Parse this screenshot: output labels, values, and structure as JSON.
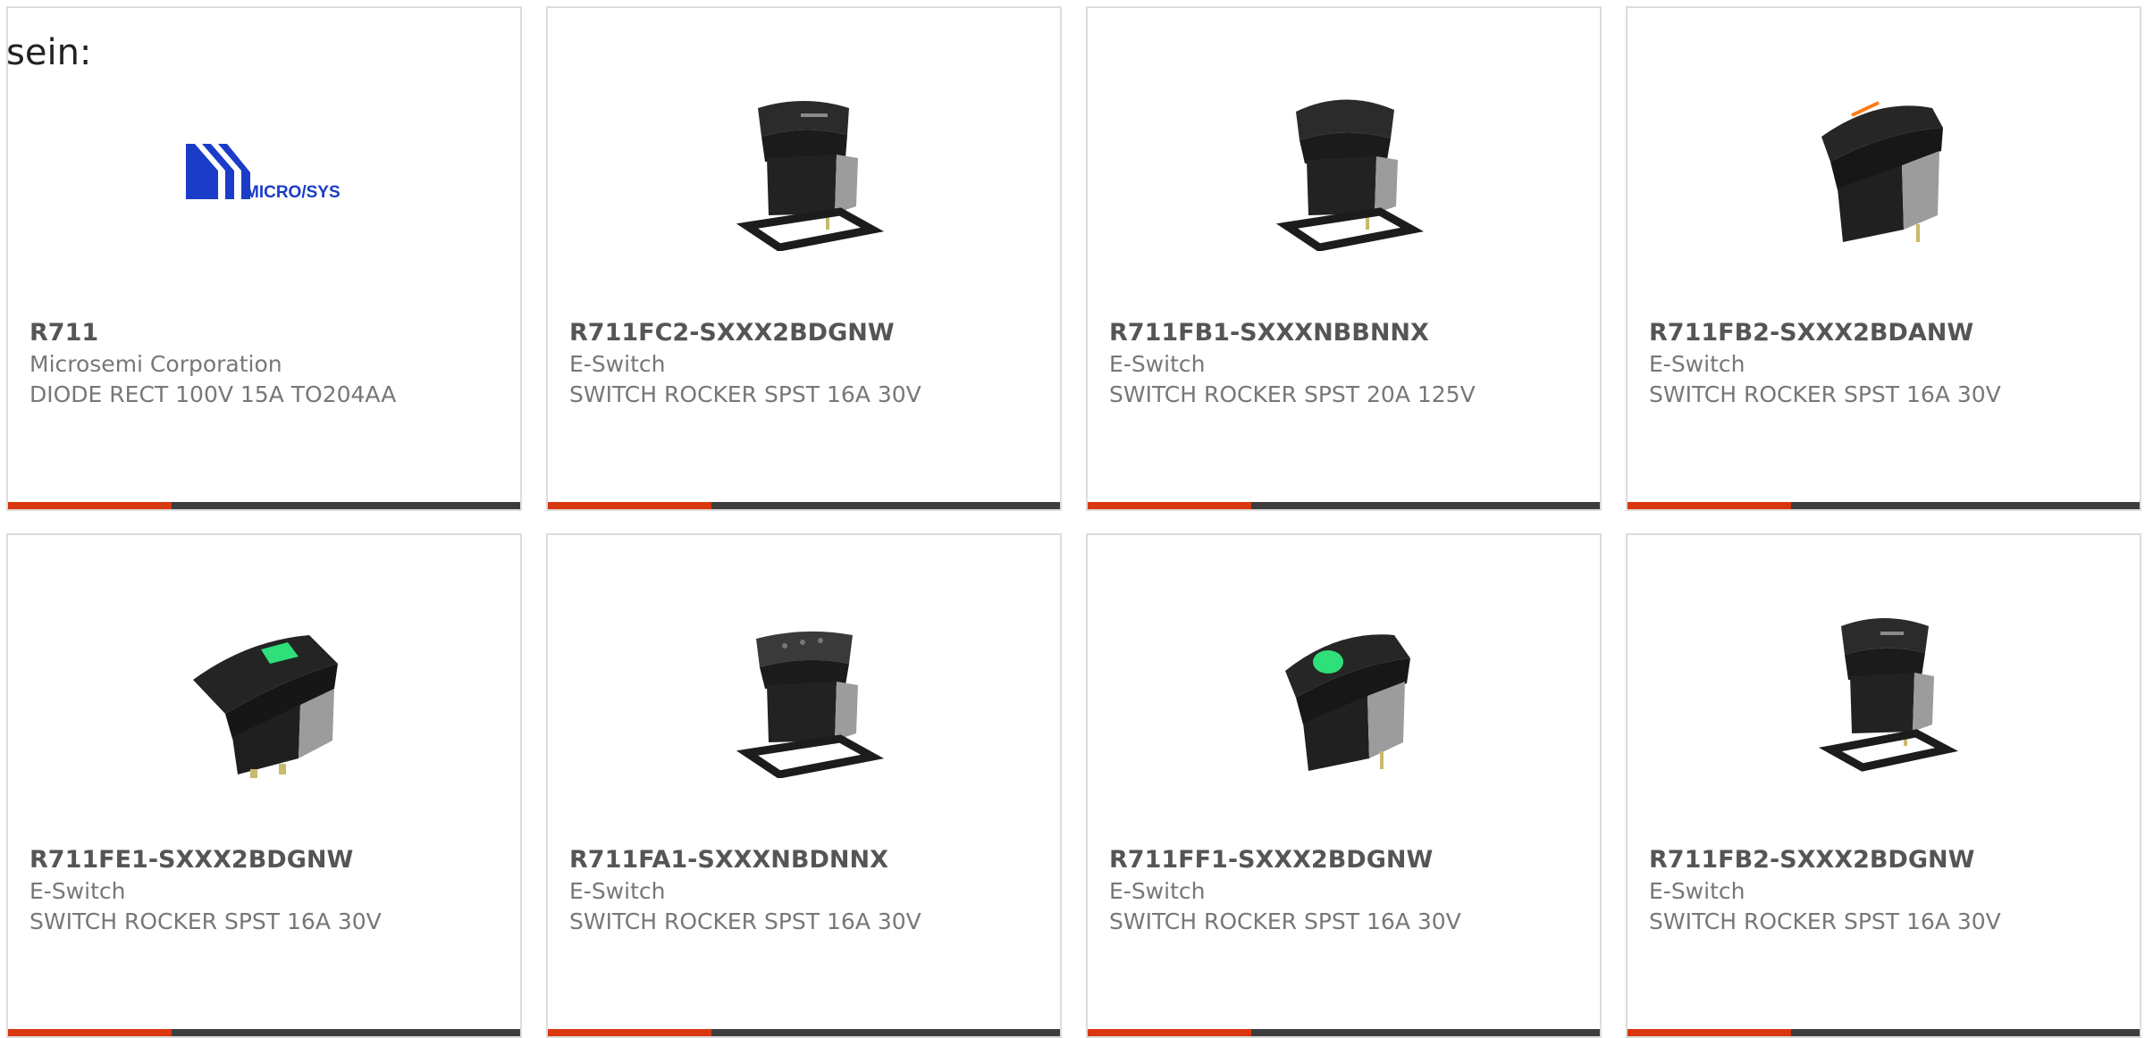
{
  "intro_text": "sein:",
  "colors": {
    "accent": "#d9370f",
    "bar": "#3d3d3d",
    "card_border": "#dcdcdc",
    "part_number": "#555555",
    "secondary_text": "#777777",
    "logo_blue": "#1a3cc8",
    "led_green": "#2fdf7a",
    "led_orange": "#ff7a1a"
  },
  "products": [
    {
      "part_number": "R711",
      "manufacturer": "Microsemi Corporation",
      "description": "DIODE RECT 100V 15A TO204AA",
      "image_icon": "microsys-logo",
      "logo_text": "MICRO/SYS"
    },
    {
      "part_number": "R711FC2-SXXX2BDGNW",
      "manufacturer": "E-Switch",
      "description": "SWITCH ROCKER SPST 16A 30V",
      "image_icon": "rocker-switch-gasket-icon"
    },
    {
      "part_number": "R711FB1-SXXXNBBNNX",
      "manufacturer": "E-Switch",
      "description": "SWITCH ROCKER SPST 20A 125V",
      "image_icon": "rocker-switch-gasket-icon"
    },
    {
      "part_number": "R711FB2-SXXX2BDANW",
      "manufacturer": "E-Switch",
      "description": "SWITCH ROCKER SPST 16A 30V",
      "image_icon": "rocker-switch-orange-stripe-icon"
    },
    {
      "part_number": "R711FE1-SXXX2BDGNW",
      "manufacturer": "E-Switch",
      "description": "SWITCH ROCKER SPST 16A 30V",
      "image_icon": "rocker-switch-green-lens-icon"
    },
    {
      "part_number": "R711FA1-SXXXNBDNNX",
      "manufacturer": "E-Switch",
      "description": "SWITCH ROCKER SPST 16A 30V",
      "image_icon": "rocker-switch-gasket-icon"
    },
    {
      "part_number": "R711FF1-SXXX2BDGNW",
      "manufacturer": "E-Switch",
      "description": "SWITCH ROCKER SPST 16A 30V",
      "image_icon": "rocker-switch-green-dot-icon"
    },
    {
      "part_number": "R711FB2-SXXX2BDGNW",
      "manufacturer": "E-Switch",
      "description": "SWITCH ROCKER SPST 16A 30V",
      "image_icon": "rocker-switch-gasket-icon"
    }
  ]
}
